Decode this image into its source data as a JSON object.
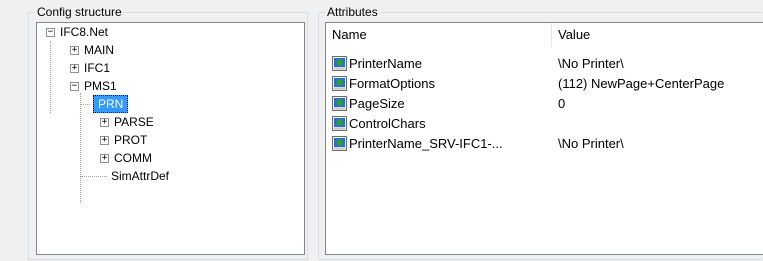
{
  "config": {
    "title": "Config structure",
    "tree": {
      "root": "IFC8.Net",
      "main": "MAIN",
      "ifc1": "IFC1",
      "pms1": "PMS1",
      "prn": "PRN",
      "parse": "PARSE",
      "prot": "PROT",
      "comm": "COMM",
      "simattr": "SimAttrDef"
    }
  },
  "attributes": {
    "title": "Attributes",
    "columns": {
      "name": "Name",
      "value": "Value"
    },
    "rows": [
      {
        "name": "PrinterName",
        "value": "\\No Printer\\"
      },
      {
        "name": "FormatOptions",
        "value": "(112) NewPage+CenterPage"
      },
      {
        "name": "PageSize",
        "value": "0"
      },
      {
        "name": "ControlChars",
        "value": ""
      },
      {
        "name": "PrinterName_SRV-IFC1-...",
        "value": "\\No Printer\\"
      }
    ],
    "icon": "attribute-icon"
  }
}
